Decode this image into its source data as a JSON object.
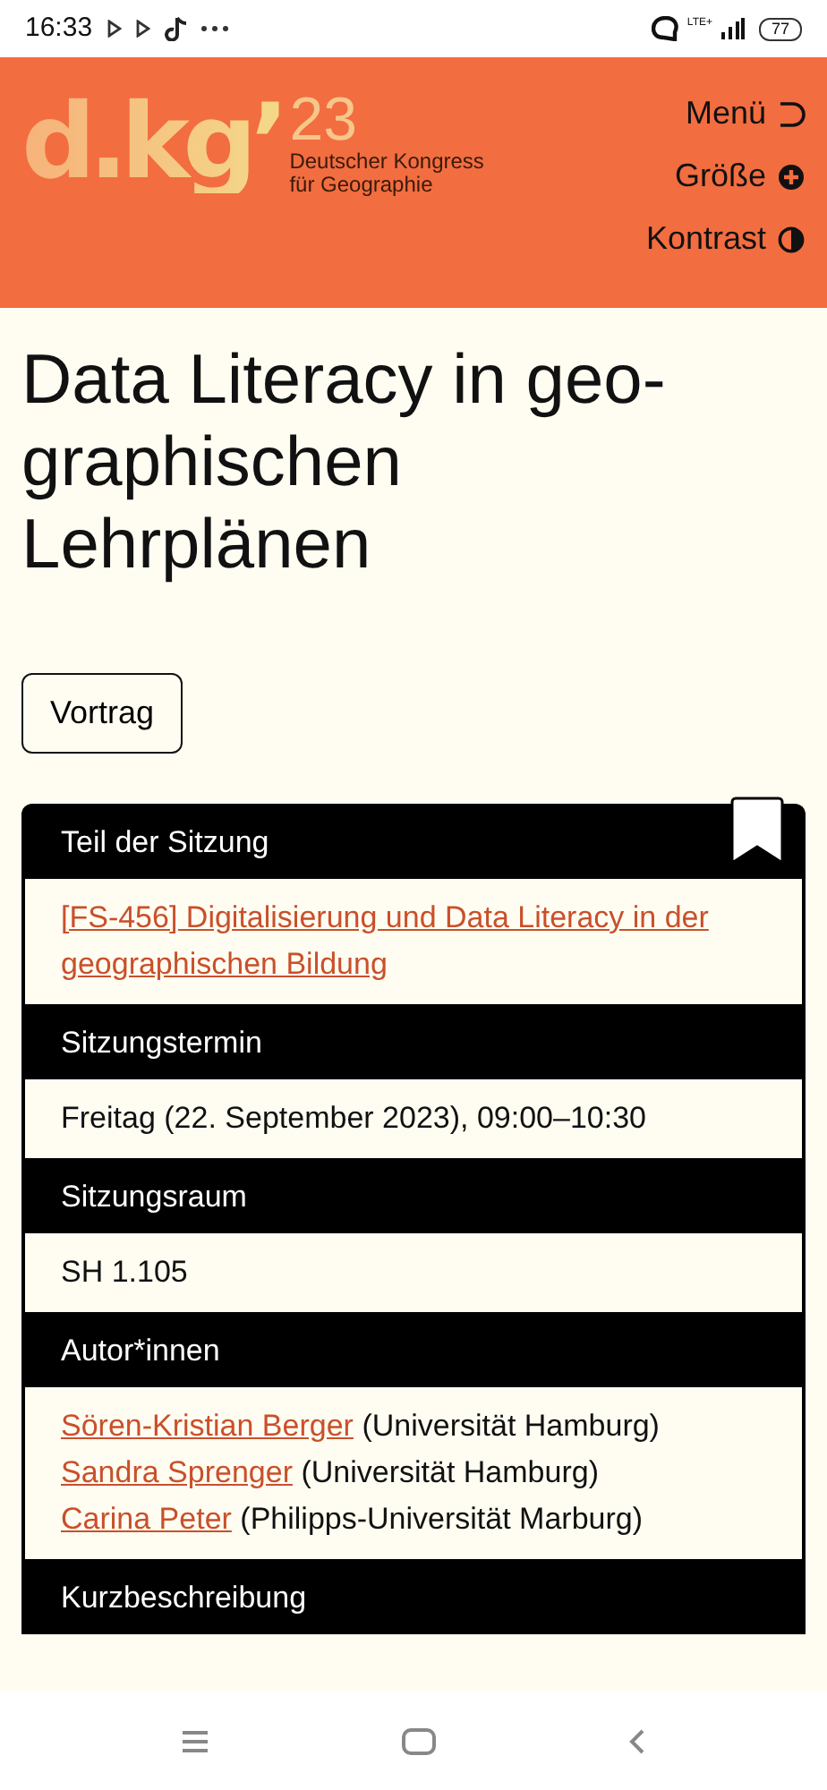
{
  "status_bar": {
    "time": "16:33",
    "network": "LTE+",
    "battery": "77"
  },
  "header": {
    "logo": {
      "mark": "d.kg’",
      "year": "23",
      "line1": "Deutscher Kongress",
      "line2": "für Geographie"
    },
    "menu": [
      {
        "label": "Menü"
      },
      {
        "label": "Größe"
      },
      {
        "label": "Kontrast"
      }
    ]
  },
  "title_lines": [
    "Data Literacy in geo-",
    "graphischen",
    "Lehrplänen"
  ],
  "tag": "Vortrag",
  "sections": [
    {
      "heading": "Teil der Sitzung",
      "kind": "link",
      "text": "[FS-456] Digitalisierung und Data Literacy in der geographischen Bildung"
    },
    {
      "heading": "Sitzungstermin",
      "kind": "text",
      "text": "Freitag (22. September 2023), 09:00–10:30"
    },
    {
      "heading": "Sitzungsraum",
      "kind": "text",
      "text": "SH 1.105"
    },
    {
      "heading": "Autor*innen",
      "kind": "authors",
      "authors": [
        {
          "name": "Sören-Kristian Berger",
          "affiliation": "(Universität Hamburg)"
        },
        {
          "name": "Sandra Sprenger",
          "affiliation": "(Universität Hamburg)"
        },
        {
          "name": "Carina Peter",
          "affiliation": "(Philipps-Universität Marburg)"
        }
      ]
    },
    {
      "heading": "Kurzbeschreibung",
      "kind": "heading_only"
    }
  ]
}
